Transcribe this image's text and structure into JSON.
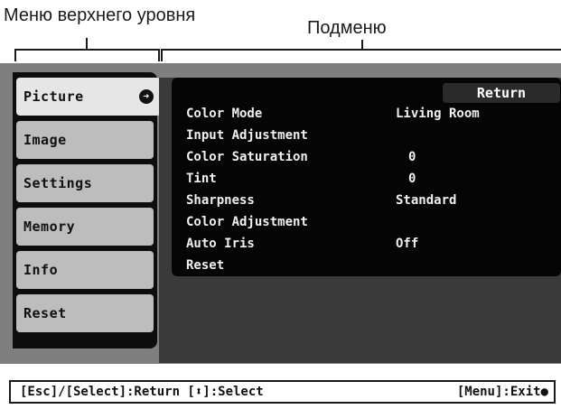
{
  "callouts": {
    "top_level_menu": "Меню верхнего уровня",
    "submenu": "Подменю"
  },
  "top_menu": {
    "items": [
      {
        "label": "Picture",
        "active": true
      },
      {
        "label": "Image"
      },
      {
        "label": "Settings"
      },
      {
        "label": "Memory"
      },
      {
        "label": "Info"
      },
      {
        "label": "Reset"
      }
    ],
    "active_icon": "right-arrow-circle-icon"
  },
  "submenu": {
    "return_label": "Return",
    "items": [
      {
        "label": "Color Mode",
        "value": "Living Room"
      },
      {
        "label": "Input Adjustment",
        "value": ""
      },
      {
        "label": "Color Saturation",
        "value": "0"
      },
      {
        "label": "Tint",
        "value": "0"
      },
      {
        "label": "Sharpness",
        "value": "Standard"
      },
      {
        "label": "Color Adjustment",
        "value": ""
      },
      {
        "label": "Auto Iris",
        "value": "Off"
      },
      {
        "label": "Reset",
        "value": ""
      }
    ]
  },
  "help_bar": {
    "left": "[Esc]/[Select]:Return [⬍]:Select",
    "right": "[Menu]:Exit●"
  }
}
